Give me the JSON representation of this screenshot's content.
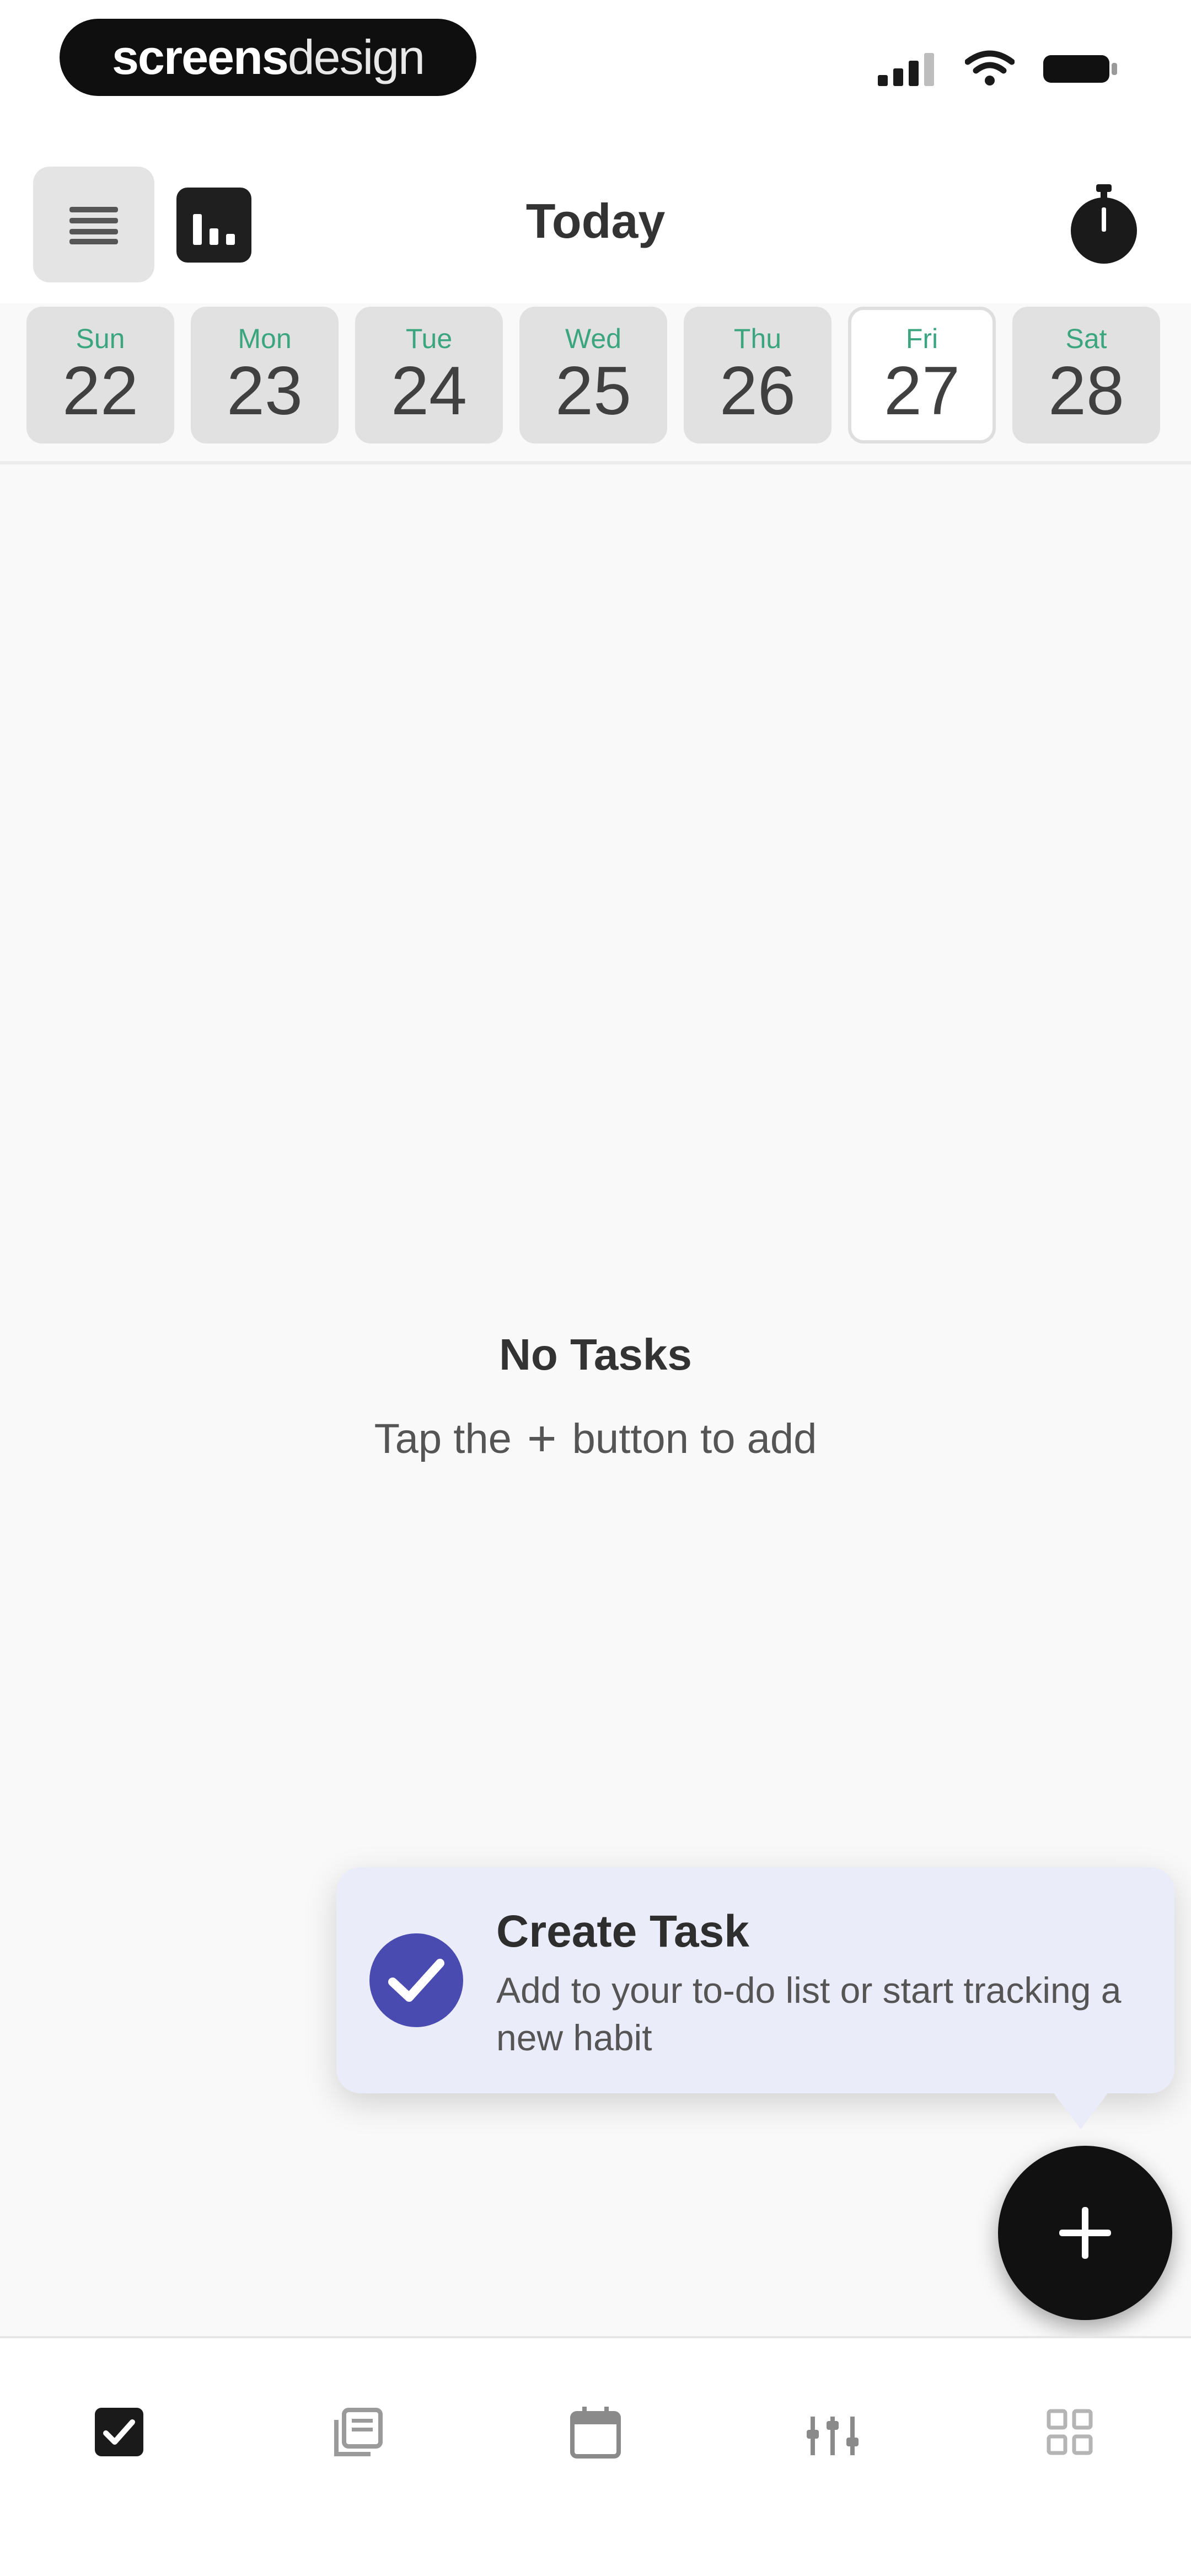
{
  "status_bar": {
    "brand_bold": "screens",
    "brand_light": "design"
  },
  "header": {
    "title": "Today",
    "menu_icon": "hamburger-menu-icon",
    "stats_icon": "bar-chart-icon",
    "timer_icon": "stopwatch-icon"
  },
  "week": [
    {
      "day": "Sun",
      "date": "22",
      "selected": false
    },
    {
      "day": "Mon",
      "date": "23",
      "selected": false
    },
    {
      "day": "Tue",
      "date": "24",
      "selected": false
    },
    {
      "day": "Wed",
      "date": "25",
      "selected": false
    },
    {
      "day": "Thu",
      "date": "26",
      "selected": false
    },
    {
      "day": "Fri",
      "date": "27",
      "selected": true
    },
    {
      "day": "Sat",
      "date": "28",
      "selected": false
    }
  ],
  "empty_state": {
    "title": "No Tasks",
    "hint_before": "Tap the",
    "hint_after": "button to add"
  },
  "tooltip": {
    "title": "Create Task",
    "description": "Add to your to-do list or start tracking a new habit"
  },
  "bottom_nav": [
    {
      "icon": "checkbox-icon",
      "active": true
    },
    {
      "icon": "notes-icon",
      "active": false
    },
    {
      "icon": "calendar-icon",
      "active": false
    },
    {
      "icon": "sliders-icon",
      "active": false
    },
    {
      "icon": "grid-settings-icon",
      "active": false
    }
  ],
  "colors": {
    "accent_green": "#3aa57e",
    "tooltip_bg": "#ebecf9",
    "check_circle": "#4a4bb0",
    "fab": "#111111"
  }
}
